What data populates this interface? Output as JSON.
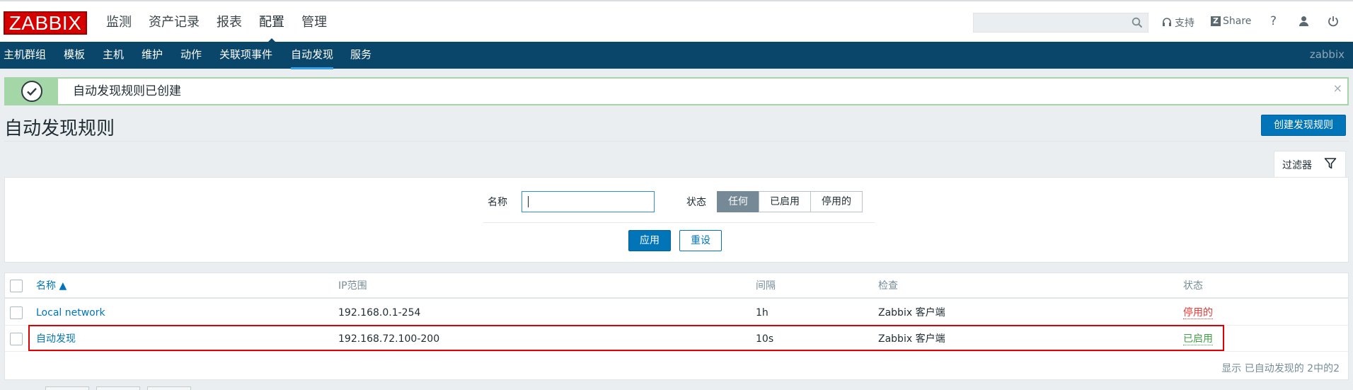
{
  "header": {
    "logo": "ZABBIX",
    "menu": [
      "监测",
      "资产记录",
      "报表",
      "配置",
      "管理"
    ],
    "active_menu_index": 3,
    "support_label": "支持",
    "share_label": "Share",
    "help_label": "?"
  },
  "subnav": {
    "items": [
      "主机群组",
      "模板",
      "主机",
      "维护",
      "动作",
      "关联项事件",
      "自动发现",
      "服务"
    ],
    "active_index": 6,
    "brand": "zabbix"
  },
  "message": {
    "text": "自动发现规则已创建",
    "close": "×"
  },
  "page": {
    "title": "自动发现规则",
    "create_button": "创建发现规则"
  },
  "filter": {
    "tab_label": "过滤器",
    "name_label": "名称",
    "name_value": "",
    "status_label": "状态",
    "status_options": [
      "任何",
      "已启用",
      "停用的"
    ],
    "status_selected": "任何",
    "apply": "应用",
    "reset": "重设"
  },
  "table": {
    "columns": [
      "名称 ▲",
      "IP范围",
      "间隔",
      "检查",
      "状态"
    ],
    "rows": [
      {
        "name": "Local network",
        "ip_range": "192.168.0.1-254",
        "interval": "1h",
        "checks": "Zabbix 客户端",
        "status": "停用的"
      },
      {
        "name": "自动发现",
        "ip_range": "192.168.72.100-200",
        "interval": "10s",
        "checks": "Zabbix 客户端",
        "status": "已启用"
      }
    ],
    "footer": "显示 已自动发现的 2中的2"
  },
  "colors": {
    "brand_red": "#d40000",
    "subnav_bg": "#0a466a",
    "primary": "#0275b8",
    "enabled": "#429e47",
    "disabled": "#e53935",
    "highlight_box": "#e00000"
  }
}
